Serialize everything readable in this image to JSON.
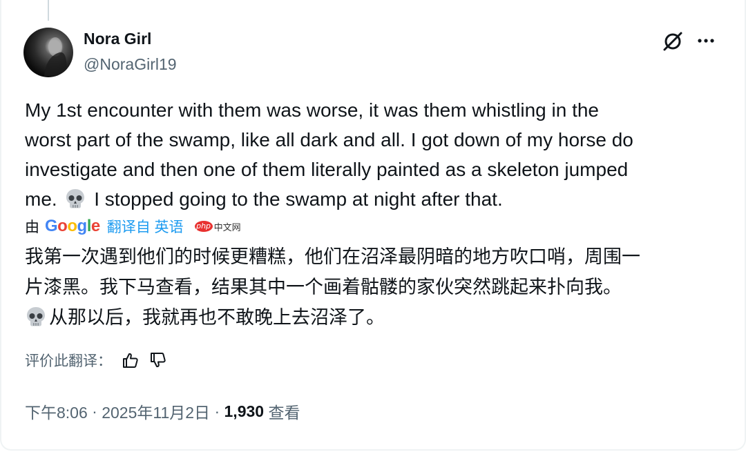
{
  "author": {
    "name": "Nora Girl",
    "handle": "@NoraGirl19"
  },
  "tweet": {
    "line1": "My 1st encounter with them was worse, it was them whistling in the",
    "line2": "worst part of the swamp, like all dark and all. I got down of my horse do",
    "line3": "investigate and then one of them literally painted as a skeleton jumped",
    "line4_before_emoji": "me.",
    "line4_after_emoji": "I stopped going to the swamp at night after that.",
    "emoji": "skull-emoji"
  },
  "translation": {
    "by_label": "由",
    "provider": "Google",
    "translated_from": "翻译自 英语",
    "watermark": "php中文网",
    "line1": "我第一次遇到他们的时候更糟糕，他们在沼泽最阴暗的地方吹口哨，周围一",
    "line2": "片漆黑。我下马查看，结果其中一个画着骷髅的家伙突然跳起来扑向我。",
    "line3": "从那以后，我就再也不敢晚上去沼泽了。"
  },
  "rating": {
    "label": "评价此翻译：",
    "thumbs_up_icon": "thumbs-up-icon",
    "thumbs_down_icon": "thumbs-down-icon"
  },
  "meta": {
    "time": "下午8:06",
    "separator": " · ",
    "date": "2025年11月2日",
    "views_count": "1,930",
    "views_label": "查看"
  },
  "icons": {
    "grok": "grok-icon",
    "more": "more-icon"
  },
  "colors": {
    "text": "#0f1419",
    "secondary": "#536471",
    "link": "#1d9bf0",
    "border": "#eff3f4"
  }
}
